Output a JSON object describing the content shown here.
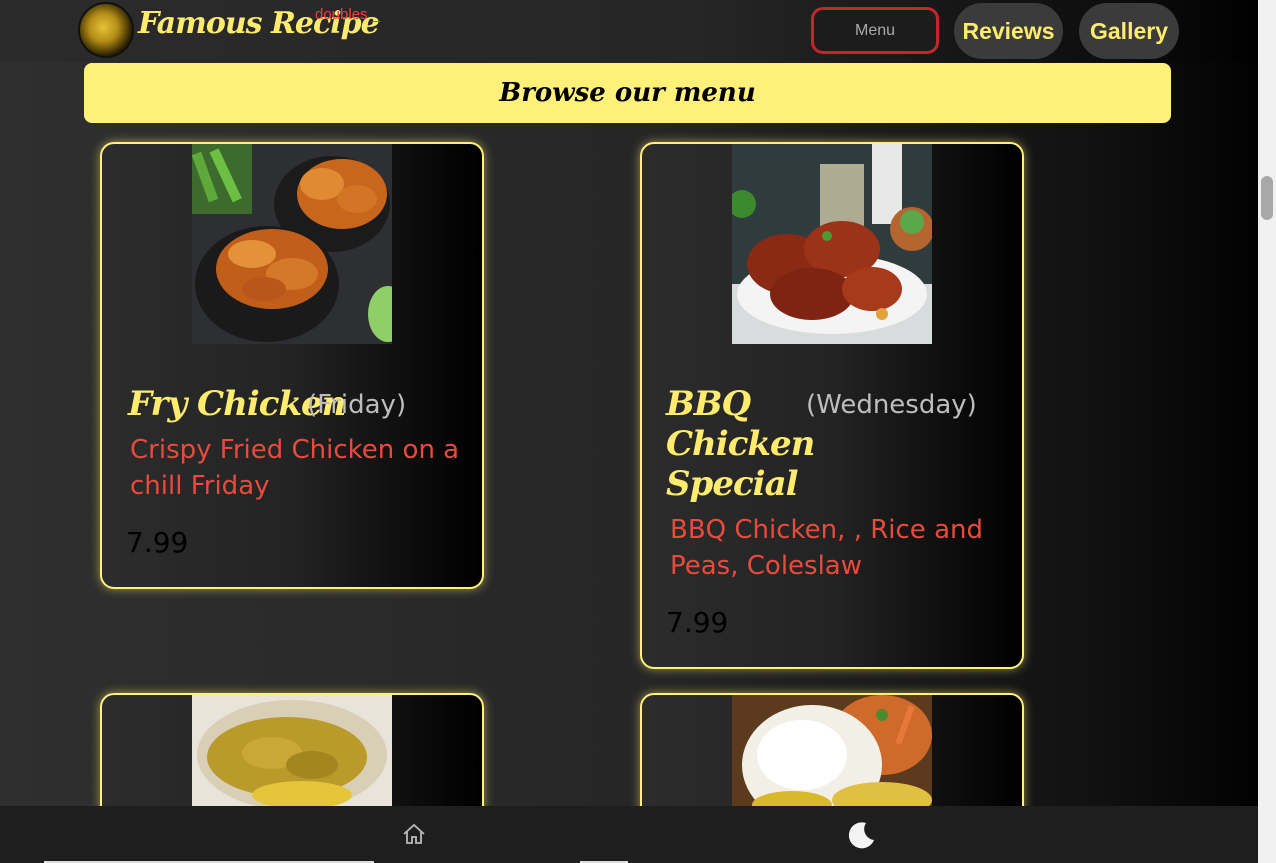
{
  "header": {
    "brand": "Famous Recipe",
    "tagline": "doubles _",
    "nav": {
      "menu": "Menu",
      "reviews": "Reviews",
      "gallery": "Gallery"
    }
  },
  "banner": {
    "title": "Browse our menu"
  },
  "menu_items": [
    {
      "name": "Fry Chicken",
      "day": "(Friday)",
      "description": "Crispy Fried Chicken on a chill Friday",
      "price": "7.99",
      "photo": "fried-chicken-photo"
    },
    {
      "name": "BBQ Chicken Special",
      "day": "(Wednesday)",
      "description": "BBQ Chicken, , Rice and Peas, Coleslaw",
      "price": "7.99",
      "photo": "bbq-chicken-photo"
    },
    {
      "photo": "roti-photo"
    },
    {
      "photo": "rice-photo"
    }
  ],
  "footer": {
    "icons": [
      "home-icon",
      "moon-icon"
    ]
  },
  "colors": {
    "accent": "#fff07a",
    "desc": "#e84a3c",
    "menu_border": "#c1272d"
  }
}
